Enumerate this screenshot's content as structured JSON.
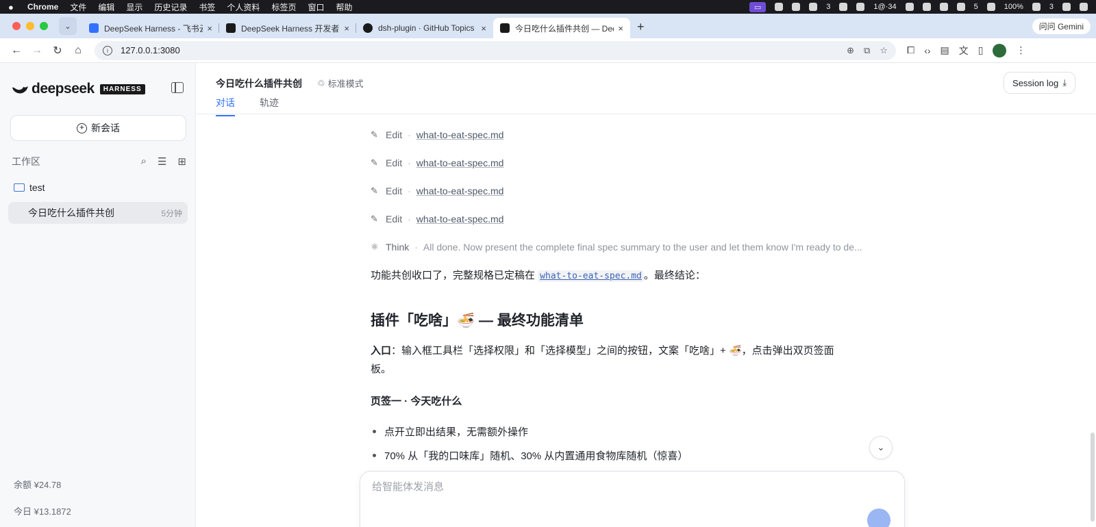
{
  "menubar": {
    "app": "Chrome",
    "items": [
      "文件",
      "编辑",
      "显示",
      "历史记录",
      "书签",
      "个人资料",
      "标签页",
      "窗口",
      "帮助"
    ],
    "status": [
      "3",
      "1@·34",
      "5",
      "100%",
      "3"
    ]
  },
  "tabs": [
    {
      "title": "DeepSeek Harness - 飞书云文档",
      "icon": "doc-icon",
      "color": "#3370ff"
    },
    {
      "title": "DeepSeek Harness 开发者预览",
      "icon": "deepseek-icon",
      "color": "#1a1a1a"
    },
    {
      "title": "dsh-plugin · GitHub Topics",
      "icon": "github-icon",
      "color": "#1a1a1a"
    },
    {
      "title": "今日吃什么插件共创 — DeepSeek",
      "icon": "deepseek-icon",
      "color": "#1a1a1a"
    }
  ],
  "gemini": "问问 Gemini",
  "address": {
    "url": "127.0.0.1:3080"
  },
  "sidebar": {
    "brand": "deepseek",
    "badge": "HARNESS",
    "new_chat": "新会话",
    "workspace_label": "工作区",
    "folder": "test",
    "session": {
      "title": "今日吃什么插件共创",
      "age": "5分钟"
    },
    "balance": "余额  ¥24.78",
    "today": "今日  ¥13.1872"
  },
  "header": {
    "title": "今日吃什么插件共创",
    "mode": "标准模式",
    "tabs": [
      "对话",
      "轨迹"
    ],
    "session_log": "Session log"
  },
  "messages": {
    "edits": [
      {
        "action": "Edit",
        "file": "what-to-eat-spec.md"
      },
      {
        "action": "Edit",
        "file": "what-to-eat-spec.md"
      },
      {
        "action": "Edit",
        "file": "what-to-eat-spec.md"
      },
      {
        "action": "Edit",
        "file": "what-to-eat-spec.md"
      }
    ],
    "think": {
      "action": "Think",
      "text": "All done. Now present the complete final spec summary to the user and let them know I'm ready to de..."
    },
    "summary_pre": "功能共创收口了，完整规格已定稿在 ",
    "summary_link": "what-to-eat-spec.md",
    "summary_post": "。最终结论：",
    "heading": "插件「吃啥」🍜 — 最终功能清单",
    "entry_label": "入口",
    "entry_line1": "：输入框工具栏「选择权限」和「选择模型」之间的按钮，文案「吃啥」+ 🍜，点击弹出双页签面",
    "entry_line2": "板。",
    "section": "页签一 · 今天吃什么",
    "bullets": [
      "点开立即出结果，无需额外操作",
      "70% 从「我的口味库」随机、30% 从内置通用食物库随机（惊喜）"
    ]
  },
  "composer": {
    "placeholder": "给智能体发消息"
  }
}
